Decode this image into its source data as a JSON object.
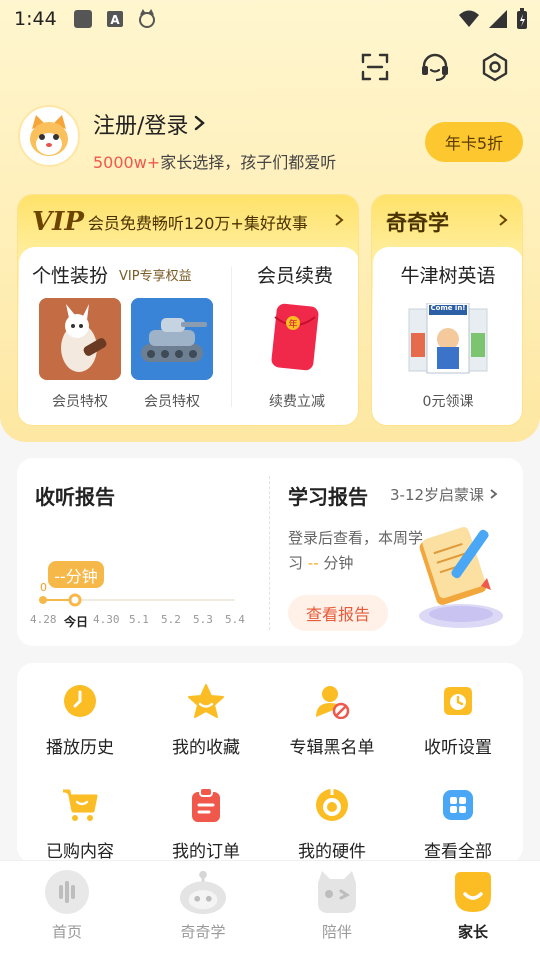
{
  "status_bar": {
    "time": "1:44"
  },
  "profile": {
    "login_label": "注册/登录",
    "subtitle_highlight": "5000w+",
    "subtitle_rest": "家长选择，孩子们都爱听",
    "annual_button": "年卡5折"
  },
  "vip_card": {
    "logo": "VIP",
    "title": "会员免费畅听120万+集好故事",
    "left_section_title": "个性装扮",
    "left_section_sub": "VIP专享权益",
    "items": [
      {
        "label": "会员特权"
      },
      {
        "label": "会员特权"
      }
    ],
    "right_section_title": "会员续费",
    "right_item_label": "续费立减",
    "redpacket_char": "年"
  },
  "qiqixue_card": {
    "title": "奇奇学",
    "item_title": "牛津树英语",
    "item_label": "0元领课",
    "book_text": "Come in!"
  },
  "listen_report": {
    "title": "收听报告",
    "bubble": "--分钟",
    "zero": "0",
    "dates": [
      "4.28",
      "今日",
      "4.30",
      "5.1",
      "5.2",
      "5.3",
      "5.4"
    ]
  },
  "study_report": {
    "title": "学习报告",
    "link": "3-12岁启蒙课",
    "desc_prefix": "登录后查看，本周学习 ",
    "desc_value": "--",
    "desc_suffix": " 分钟",
    "button": "查看报告"
  },
  "menu": [
    {
      "label": "播放历史",
      "icon": "play-history-icon"
    },
    {
      "label": "我的收藏",
      "icon": "star-icon"
    },
    {
      "label": "专辑黑名单",
      "icon": "blacklist-icon"
    },
    {
      "label": "收听设置",
      "icon": "listen-settings-icon"
    },
    {
      "label": "已购内容",
      "icon": "cart-icon"
    },
    {
      "label": "我的订单",
      "icon": "order-icon"
    },
    {
      "label": "我的硬件",
      "icon": "hardware-icon"
    },
    {
      "label": "查看全部",
      "icon": "grid-icon"
    }
  ],
  "tabs": [
    {
      "label": "首页",
      "active": false
    },
    {
      "label": "奇奇学",
      "active": false
    },
    {
      "label": "陪伴",
      "active": false
    },
    {
      "label": "家长",
      "active": true
    }
  ],
  "colors": {
    "accent_yellow": "#fcc72f",
    "highlight_red": "#f0584c",
    "report_button_text": "#e65b3a",
    "menu_icon_yellow": "#fbbd23",
    "menu_icon_red": "#f0584c",
    "menu_icon_blue": "#4aa7f5"
  }
}
